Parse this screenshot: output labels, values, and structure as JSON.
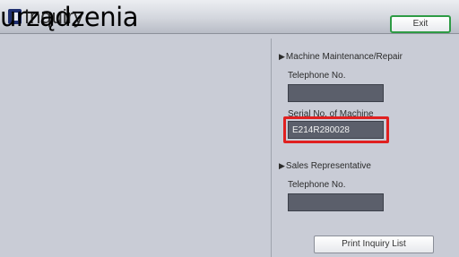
{
  "header": {
    "title": "Inquiry",
    "overlay_text": "urządzenia",
    "exit_label": "Exit",
    "icon": "inquiry-icon"
  },
  "maintenance": {
    "heading": "Machine Maintenance/Repair",
    "telephone_label": "Telephone No.",
    "telephone_value": "",
    "serial_label": "Serial No. of Machine",
    "serial_value": "E214R280028"
  },
  "sales": {
    "heading": "Sales Representative",
    "telephone_label": "Telephone No.",
    "telephone_value": ""
  },
  "print_button_label": "Print Inquiry List",
  "colors": {
    "highlight": "#e02020",
    "exit_border": "#2e9b45",
    "field_background": "#5b5f6b"
  }
}
